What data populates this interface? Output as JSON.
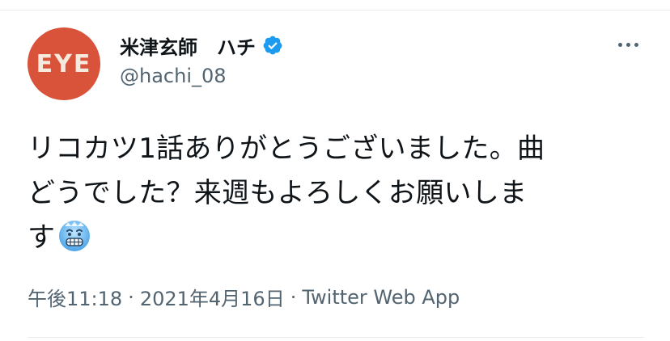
{
  "avatar": {
    "text": "EYE",
    "bg": "#d9523a"
  },
  "author": {
    "name": "米津玄師　ハチ",
    "handle": "@hachi_08",
    "verified": true,
    "verified_color": "#1d9bf0"
  },
  "tweet": {
    "line1": "リコカツ1話ありがとうございました。曲",
    "line2": "どうでした？来週もよろしくお願いしま",
    "line3": "す",
    "emoji": "cold-face-emoji"
  },
  "meta": {
    "time": "午後11:18",
    "separator": "·",
    "date": "2021年4月16日",
    "source": "Twitter Web App"
  },
  "icons": {
    "more": "more-horizontal-icon",
    "verified": "verified-badge-icon"
  }
}
